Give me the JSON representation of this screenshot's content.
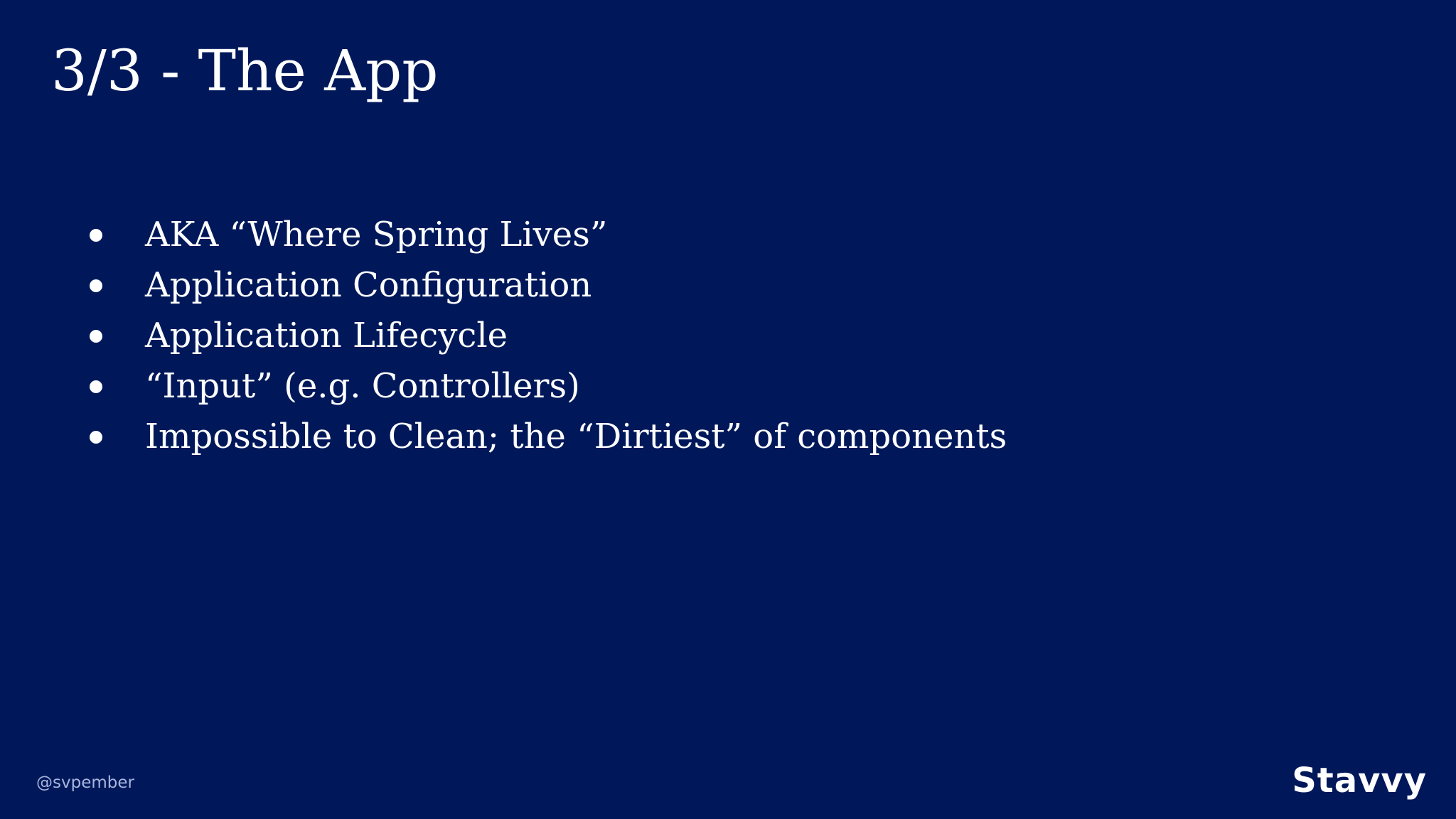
{
  "slide": {
    "title": "3/3 - The App",
    "bullets": [
      "AKA “Where Spring Lives”",
      "Application Configuration",
      "Application Lifecycle",
      "“Input” (e.g. Controllers)",
      "Impossible to Clean; the “Dirtiest” of components"
    ],
    "footer_handle": "@svpember",
    "brand_logo": "Stavvy"
  },
  "colors": {
    "background": "#00185a",
    "text": "#ffffff",
    "footer_text": "#a9b5dd"
  }
}
